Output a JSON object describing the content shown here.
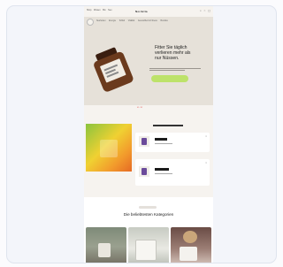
{
  "nav": {
    "links": [
      "Shop",
      "Wissen",
      "Bio",
      "Neu"
    ],
    "brand": "Nordvita",
    "icons": [
      "search-icon",
      "account-icon",
      "cart-icon"
    ]
  },
  "categories": [
    "Neuheiten",
    "Energie",
    "Schlaf",
    "Vitalität",
    "Gesundheit & Fitness",
    "Bundles"
  ],
  "hero": {
    "headline_lines": [
      "Fitter Sie täglich",
      "verlieren mehr als",
      "nur Nüssen."
    ],
    "pager": "01 / 02"
  },
  "section": {
    "title": "Die beliebtesten Kategorien"
  },
  "colors": {
    "cta": "#bde26a",
    "jar": "#6b3a1d",
    "hero_bg": "#e6e1d9"
  }
}
